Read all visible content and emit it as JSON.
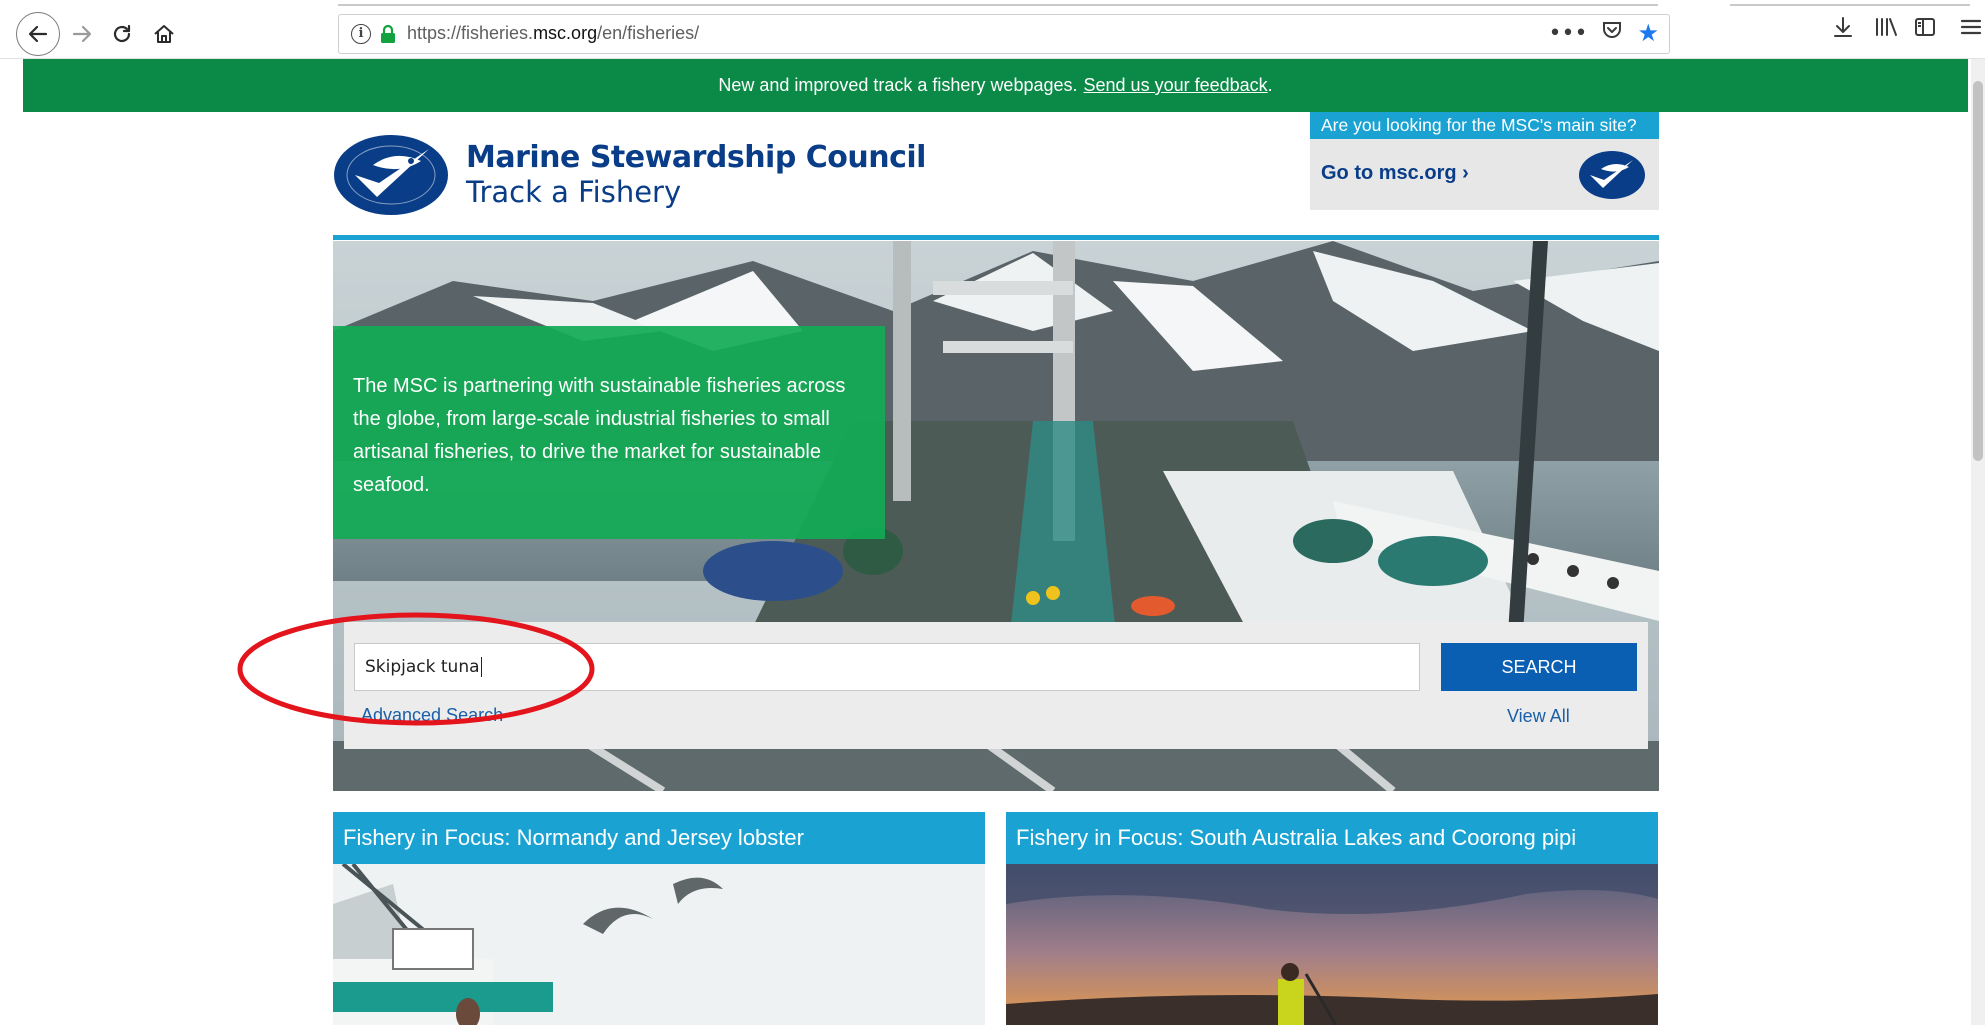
{
  "browser": {
    "url_prefix": "https://fisheries.",
    "url_domain": "msc.org",
    "url_path": "/en/fisheries/",
    "info_glyph": "i",
    "icons": [
      "back-icon",
      "forward-icon",
      "reload-icon",
      "home-icon",
      "info-icon",
      "lock-icon",
      "more-icon",
      "pocket-icon",
      "bookmark-star-icon",
      "download-icon",
      "library-icon",
      "sidebar-icon",
      "menu-icon"
    ]
  },
  "banner": {
    "text": "New and improved track a fishery webpages.",
    "link_text": "Send us your feedback",
    "suffix": ".",
    "color": "#0b8a47"
  },
  "header": {
    "brand_title": "Marine Stewardship Council",
    "brand_subtitle": "Track a Fishery",
    "main_site_question": "Are you looking for the MSC's main site?",
    "goto_link": "Go to msc.org ›",
    "brand_color": "#0a3d87",
    "accent_color": "#1aa3d2"
  },
  "hero": {
    "intro_text": "The MSC is partnering with sustainable fisheries across the globe, from large-scale industrial fisheries to small artisanal fisheries, to drive the market for sustainable seafood."
  },
  "search": {
    "value": "Skipjack tuna",
    "button_label": "SEARCH",
    "advanced_link": "Advanced Search",
    "view_all_link": "View All",
    "button_color": "#0b5fb3"
  },
  "focus_cards": [
    {
      "title": "Fishery in Focus: Normandy and Jersey lobster"
    },
    {
      "title": "Fishery in Focus: South Australia Lakes and Coorong pipi"
    }
  ],
  "annotation": {
    "color": "#e3141b",
    "shape": "ellipse-around-search-input"
  }
}
